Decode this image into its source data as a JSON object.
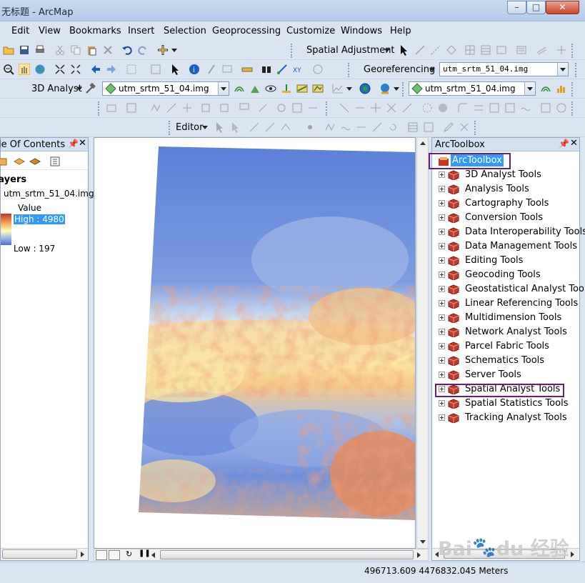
{
  "window": {
    "title": "无标题 - ArcMap",
    "buttons": {
      "minimize": "–",
      "maximize": "□",
      "close": "✕"
    }
  },
  "menubar": [
    "Edit",
    "View",
    "Bookmarks",
    "Insert",
    "Selection",
    "Geoprocessing",
    "Customize",
    "Windows",
    "Help"
  ],
  "toolbars": {
    "spatial_adjustment_label": "Spatial Adjustment",
    "georeferencing_label": "Georeferencing",
    "georef_layer": "utm_srtm_51_04.img",
    "analyst3d_label": "3D Analyst",
    "analyst3d_layer": "utm_srtm_51_04.img",
    "spatial_analyst_layer": "utm_srtm_51_04.img",
    "editor_label": "Editor"
  },
  "toc": {
    "title": "Table Of Contents",
    "layers_label": "Layers",
    "layer_name": "utm_srtm_51_04.img",
    "value_label": "Value",
    "high_label": "High : 4980",
    "low_label": "Low : 197",
    "colors": {
      "high": "#c2372c",
      "mid": "#fdfcb8",
      "low": "#4a6fd6"
    }
  },
  "toolbox": {
    "title": "ArcToolbox",
    "root": "ArcToolbox",
    "items": [
      "3D Analyst Tools",
      "Analysis Tools",
      "Cartography Tools",
      "Conversion Tools",
      "Data Interoperability Tools",
      "Data Management Tools",
      "Editing Tools",
      "Geocoding Tools",
      "Geostatistical Analyst Tools",
      "Linear Referencing Tools",
      "Multidimension Tools",
      "Network Analyst Tools",
      "Parcel Fabric Tools",
      "Schematics Tools",
      "Server Tools",
      "Spatial Analyst Tools",
      "Spatial Statistics Tools",
      "Tracking Analyst Tools"
    ],
    "highlighted_item": "Spatial Analyst Tools",
    "highlight_color": "#6b1d7c"
  },
  "status": {
    "coordinates": "496713.609  4476832.045 Meters"
  },
  "watermark": "Baidu 经验"
}
